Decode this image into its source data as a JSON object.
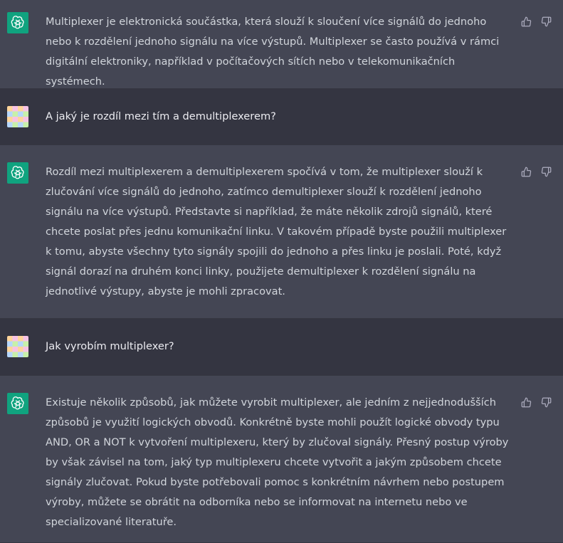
{
  "messages": [
    {
      "role": "assistant",
      "avatar_icon": "openai-logo-icon",
      "text": "Multiplexer je elektronická součástka, která slouží k sloučení více signálů do jednoho nebo k rozdělení jednoho signálu na více výstupů. Multiplexer se často používá v rámci digitální elektroniky, například v počítačových sítích nebo v telekomunikačních systémech."
    },
    {
      "role": "user",
      "avatar_icon": "user-avatar",
      "text": "A jaký je rozdíl mezi tím a demultiplexerem?"
    },
    {
      "role": "assistant",
      "avatar_icon": "openai-logo-icon",
      "text": "Rozdíl mezi multiplexerem a demultiplexerem spočívá v tom, že multiplexer slouží k zlučování více signálů do jednoho, zatímco demultiplexer slouží k rozdělení jednoho signálu na více výstupů. Představte si například, že máte několik zdrojů signálů, které chcete poslat přes jednu komunikační linku. V takovém případě byste použili multiplexer k tomu, abyste všechny tyto signály spojili do jednoho a přes linku je poslali. Poté, když signál dorazí na druhém konci linky, použijete demultiplexer k rozdělení signálu na jednotlivé výstupy, abyste je mohli zpracovat."
    },
    {
      "role": "user",
      "avatar_icon": "user-avatar",
      "text": "Jak vyrobím multiplexer?"
    },
    {
      "role": "assistant",
      "avatar_icon": "openai-logo-icon",
      "text": "Existuje několik způsobů, jak můžete vyrobit multiplexer, ale jedním z nejjednodušších způsobů je využití logických obvodů. Konkrétně byste mohli použít logické obvody typu AND, OR a NOT k vytvoření multiplexeru, který by zlučoval signály. Přesný postup výroby by však závisel na tom, jaký typ multiplexeru chcete vytvořit a jakým způsobem chcete signály zlučovat. Pokud byste potřebovali pomoc s konkrétním návrhem nebo postupem výroby, můžete se obrátit na odborníka nebo se informovat na internetu nebo ve specializované literatuře."
    }
  ],
  "icons": {
    "thumbs_up": "thumbs-up-icon",
    "thumbs_down": "thumbs-down-icon"
  },
  "colors": {
    "assistant_bg": "#444654",
    "user_bg": "#343541",
    "openai_green": "#10a37f",
    "text": "#d1d5db",
    "icon": "#acacbe"
  }
}
